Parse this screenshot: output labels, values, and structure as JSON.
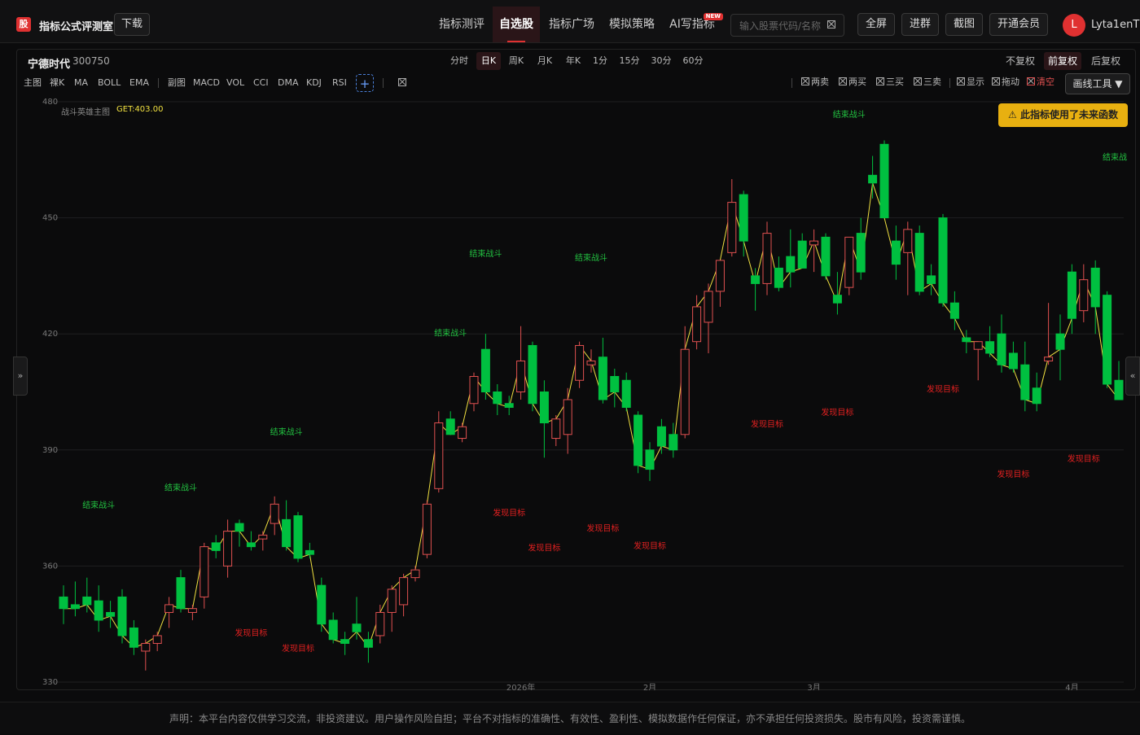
{
  "header": {
    "logo_text": "股",
    "app_title": "指标公式评测室",
    "download_label": "下载",
    "nav": [
      {
        "label": "指标测评",
        "active": false
      },
      {
        "label": "自选股",
        "active": true
      },
      {
        "label": "指标广场",
        "active": false
      },
      {
        "label": "模拟策略",
        "active": false
      },
      {
        "label": "AI写指标",
        "active": false,
        "badge": "NEW"
      }
    ],
    "search_placeholder": "输入股票代码/名称",
    "buttons": [
      "全屏",
      "进群",
      "截图",
      "开通会员"
    ],
    "avatar_letter": "L",
    "username": "Lyta1enT"
  },
  "stock": {
    "name": "宁德时代",
    "code": "300750"
  },
  "periods": [
    {
      "label": "分时",
      "active": false
    },
    {
      "label": "日K",
      "active": true
    },
    {
      "label": "周K",
      "active": false
    },
    {
      "label": "月K",
      "active": false
    },
    {
      "label": "年K",
      "active": false
    },
    {
      "label": "1分",
      "active": false
    },
    {
      "label": "15分",
      "active": false
    },
    {
      "label": "30分",
      "active": false
    },
    {
      "label": "60分",
      "active": false
    }
  ],
  "adjust": [
    {
      "label": "不复权",
      "active": false
    },
    {
      "label": "前复权",
      "active": true
    },
    {
      "label": "后复权",
      "active": false
    }
  ],
  "indicators": {
    "main_label": "主图",
    "main": [
      "裸K",
      "MA",
      "BOLL",
      "EMA"
    ],
    "sub_label": "副图",
    "sub": [
      "MACD",
      "VOL",
      "CCI",
      "DMA",
      "KDJ",
      "RSI"
    ],
    "add_symbol": "+"
  },
  "signals": [
    {
      "label": "两卖",
      "red": false
    },
    {
      "label": "两买",
      "red": false
    },
    {
      "label": "三买",
      "red": false
    },
    {
      "label": "三卖",
      "red": false
    },
    {
      "label": "显示",
      "red": false
    },
    {
      "label": "拖动",
      "red": false
    },
    {
      "label": "清空",
      "red": true
    }
  ],
  "draw_tools_label": "画线工具 ▼",
  "warning_text": "⚠ 此指标使用了未来函数",
  "legend": {
    "name": "战斗英雄主图",
    "value": "GET:403.00"
  },
  "side_left": "»",
  "side_right": "«",
  "chart_data": {
    "type": "candlestick",
    "ylim": [
      330,
      480
    ],
    "yticks": [
      330,
      360,
      390,
      420,
      450,
      480
    ],
    "xticks": [
      {
        "index": 39,
        "label": "2026年"
      },
      {
        "index": 50,
        "label": "2月"
      },
      {
        "index": 64,
        "label": "3月"
      },
      {
        "index": 86,
        "label": "4月"
      }
    ],
    "up_color": "#e05050",
    "down_color": "#00c040",
    "line_color": "#f0e040",
    "candles": [
      {
        "o": 352,
        "h": 355,
        "l": 345,
        "c": 349
      },
      {
        "o": 350,
        "h": 356,
        "l": 347,
        "c": 349
      },
      {
        "o": 352,
        "h": 357,
        "l": 348,
        "c": 350
      },
      {
        "o": 351,
        "h": 355,
        "l": 343,
        "c": 346
      },
      {
        "o": 348,
        "h": 351,
        "l": 344,
        "c": 347
      },
      {
        "o": 352,
        "h": 354,
        "l": 340,
        "c": 342
      },
      {
        "o": 344,
        "h": 346,
        "l": 337,
        "c": 339
      },
      {
        "o": 338,
        "h": 341,
        "l": 333,
        "c": 340
      },
      {
        "o": 340,
        "h": 343,
        "l": 338,
        "c": 342
      },
      {
        "o": 348,
        "h": 352,
        "l": 344,
        "c": 350
      },
      {
        "o": 357,
        "h": 359,
        "l": 348,
        "c": 349
      },
      {
        "o": 348,
        "h": 350,
        "l": 346,
        "c": 349
      },
      {
        "o": 352,
        "h": 366,
        "l": 349,
        "c": 365
      },
      {
        "o": 366,
        "h": 368,
        "l": 362,
        "c": 364
      },
      {
        "o": 360,
        "h": 372,
        "l": 357,
        "c": 369
      },
      {
        "o": 371,
        "h": 372,
        "l": 365,
        "c": 369
      },
      {
        "o": 366,
        "h": 369,
        "l": 364,
        "c": 365
      },
      {
        "o": 367,
        "h": 369,
        "l": 364,
        "c": 368
      },
      {
        "o": 371,
        "h": 378,
        "l": 368,
        "c": 376
      },
      {
        "o": 372,
        "h": 377,
        "l": 364,
        "c": 365
      },
      {
        "o": 373,
        "h": 374,
        "l": 361,
        "c": 362
      },
      {
        "o": 364,
        "h": 366,
        "l": 362,
        "c": 363
      },
      {
        "o": 355,
        "h": 357,
        "l": 343,
        "c": 345
      },
      {
        "o": 346,
        "h": 348,
        "l": 340,
        "c": 341
      },
      {
        "o": 341,
        "h": 343,
        "l": 337,
        "c": 340
      },
      {
        "o": 345,
        "h": 352,
        "l": 341,
        "c": 343
      },
      {
        "o": 341,
        "h": 343,
        "l": 335,
        "c": 339
      },
      {
        "o": 342,
        "h": 350,
        "l": 340,
        "c": 348
      },
      {
        "o": 348,
        "h": 355,
        "l": 343,
        "c": 354
      },
      {
        "o": 350,
        "h": 358,
        "l": 347,
        "c": 357
      },
      {
        "o": 357,
        "h": 360,
        "l": 356,
        "c": 359
      },
      {
        "o": 363,
        "h": 377,
        "l": 362,
        "c": 376
      },
      {
        "o": 380,
        "h": 400,
        "l": 379,
        "c": 397
      },
      {
        "o": 398,
        "h": 400,
        "l": 395,
        "c": 394
      },
      {
        "o": 393,
        "h": 397,
        "l": 392,
        "c": 396
      },
      {
        "o": 402,
        "h": 410,
        "l": 400,
        "c": 409
      },
      {
        "o": 416,
        "h": 420,
        "l": 403,
        "c": 405
      },
      {
        "o": 405,
        "h": 407,
        "l": 399,
        "c": 402
      },
      {
        "o": 402,
        "h": 404,
        "l": 399,
        "c": 401
      },
      {
        "o": 405,
        "h": 422,
        "l": 403,
        "c": 413
      },
      {
        "o": 417,
        "h": 418,
        "l": 400,
        "c": 402
      },
      {
        "o": 405,
        "h": 408,
        "l": 388,
        "c": 397
      },
      {
        "o": 393,
        "h": 399,
        "l": 391,
        "c": 398
      },
      {
        "o": 394,
        "h": 406,
        "l": 389,
        "c": 403
      },
      {
        "o": 408,
        "h": 418,
        "l": 406,
        "c": 417
      },
      {
        "o": 412,
        "h": 416,
        "l": 410,
        "c": 413
      },
      {
        "o": 414,
        "h": 419,
        "l": 402,
        "c": 403
      },
      {
        "o": 409,
        "h": 411,
        "l": 401,
        "c": 405
      },
      {
        "o": 408,
        "h": 410,
        "l": 400,
        "c": 401
      },
      {
        "o": 399,
        "h": 400,
        "l": 384,
        "c": 386
      },
      {
        "o": 390,
        "h": 392,
        "l": 382,
        "c": 385
      },
      {
        "o": 396,
        "h": 398,
        "l": 389,
        "c": 391
      },
      {
        "o": 394,
        "h": 397,
        "l": 388,
        "c": 390
      },
      {
        "o": 394,
        "h": 422,
        "l": 393,
        "c": 416
      },
      {
        "o": 418,
        "h": 430,
        "l": 416,
        "c": 427
      },
      {
        "o": 423,
        "h": 433,
        "l": 415,
        "c": 431
      },
      {
        "o": 431,
        "h": 437,
        "l": 427,
        "c": 439
      },
      {
        "o": 441,
        "h": 460,
        "l": 440,
        "c": 454
      },
      {
        "o": 456,
        "h": 457,
        "l": 440,
        "c": 444
      },
      {
        "o": 435,
        "h": 437,
        "l": 426,
        "c": 433
      },
      {
        "o": 433,
        "h": 449,
        "l": 430,
        "c": 446
      },
      {
        "o": 437,
        "h": 440,
        "l": 431,
        "c": 432
      },
      {
        "o": 440,
        "h": 447,
        "l": 432,
        "c": 436
      },
      {
        "o": 444,
        "h": 446,
        "l": 437,
        "c": 437
      },
      {
        "o": 443,
        "h": 447,
        "l": 436,
        "c": 444
      },
      {
        "o": 445,
        "h": 446,
        "l": 434,
        "c": 435
      },
      {
        "o": 430,
        "h": 436,
        "l": 425,
        "c": 428
      },
      {
        "o": 432,
        "h": 445,
        "l": 430,
        "c": 445
      },
      {
        "o": 446,
        "h": 450,
        "l": 434,
        "c": 436
      },
      {
        "o": 461,
        "h": 466,
        "l": 455,
        "c": 459
      },
      {
        "o": 469,
        "h": 470,
        "l": 450,
        "c": 450
      },
      {
        "o": 444,
        "h": 448,
        "l": 434,
        "c": 438
      },
      {
        "o": 441,
        "h": 449,
        "l": 430,
        "c": 447
      },
      {
        "o": 446,
        "h": 448,
        "l": 430,
        "c": 431
      },
      {
        "o": 435,
        "h": 438,
        "l": 430,
        "c": 433
      },
      {
        "o": 450,
        "h": 451,
        "l": 427,
        "c": 428
      },
      {
        "o": 428,
        "h": 431,
        "l": 421,
        "c": 424
      },
      {
        "o": 419,
        "h": 421,
        "l": 415,
        "c": 418
      },
      {
        "o": 416,
        "h": 418,
        "l": 408,
        "c": 418
      },
      {
        "o": 418,
        "h": 422,
        "l": 414,
        "c": 415
      },
      {
        "o": 420,
        "h": 425,
        "l": 410,
        "c": 412
      },
      {
        "o": 415,
        "h": 418,
        "l": 410,
        "c": 411
      },
      {
        "o": 412,
        "h": 418,
        "l": 400,
        "c": 403
      },
      {
        "o": 406,
        "h": 410,
        "l": 400,
        "c": 402
      },
      {
        "o": 413,
        "h": 428,
        "l": 412,
        "c": 414
      },
      {
        "o": 420,
        "h": 425,
        "l": 408,
        "c": 416
      },
      {
        "o": 436,
        "h": 438,
        "l": 420,
        "c": 424
      },
      {
        "o": 426,
        "h": 438,
        "l": 423,
        "c": 434
      },
      {
        "o": 437,
        "h": 439,
        "l": 420,
        "c": 427
      },
      {
        "o": 430,
        "h": 431,
        "l": 406,
        "c": 407
      },
      {
        "o": 408,
        "h": 413,
        "l": 404,
        "c": 403
      }
    ],
    "annotations": [
      {
        "index": 3,
        "price": 375,
        "text": "结束战斗",
        "color": "green"
      },
      {
        "index": 10,
        "price": 379.5,
        "text": "结束战斗",
        "color": "green"
      },
      {
        "index": 19,
        "price": 394,
        "text": "结束战斗",
        "color": "green"
      },
      {
        "index": 16,
        "price": 342,
        "text": "发现目标",
        "color": "red"
      },
      {
        "index": 20,
        "price": 338,
        "text": "发现目标",
        "color": "red"
      },
      {
        "index": 33,
        "price": 419.5,
        "text": "结束战斗",
        "color": "green"
      },
      {
        "index": 36,
        "price": 440,
        "text": "结束战斗",
        "color": "green"
      },
      {
        "index": 45,
        "price": 439,
        "text": "结束战斗",
        "color": "green"
      },
      {
        "index": 38,
        "price": 373,
        "text": "发现目标",
        "color": "red"
      },
      {
        "index": 41,
        "price": 364,
        "text": "发现目标",
        "color": "red"
      },
      {
        "index": 46,
        "price": 369,
        "text": "发现目标",
        "color": "red"
      },
      {
        "index": 50,
        "price": 364.5,
        "text": "发现目标",
        "color": "red"
      },
      {
        "index": 60,
        "price": 396,
        "text": "发现目标",
        "color": "red"
      },
      {
        "index": 66,
        "price": 399,
        "text": "发现目标",
        "color": "red"
      },
      {
        "index": 67,
        "price": 476,
        "text": "结束战斗",
        "color": "green"
      },
      {
        "index": 75,
        "price": 405,
        "text": "发现目标",
        "color": "red"
      },
      {
        "index": 81,
        "price": 383,
        "text": "发现目标",
        "color": "red"
      },
      {
        "index": 87,
        "price": 387,
        "text": "发现目标",
        "color": "red"
      },
      {
        "index": 90,
        "price": 465,
        "text": "结束战斗",
        "color": "green"
      }
    ]
  },
  "disclaimer": "声明：本平台内容仅供学习交流，非投资建议。用户操作风险自担；平台不对指标的准确性、有效性、盈利性、模拟数据作任何保证，亦不承担任何投资损失。股市有风险，投资需谨慎。"
}
